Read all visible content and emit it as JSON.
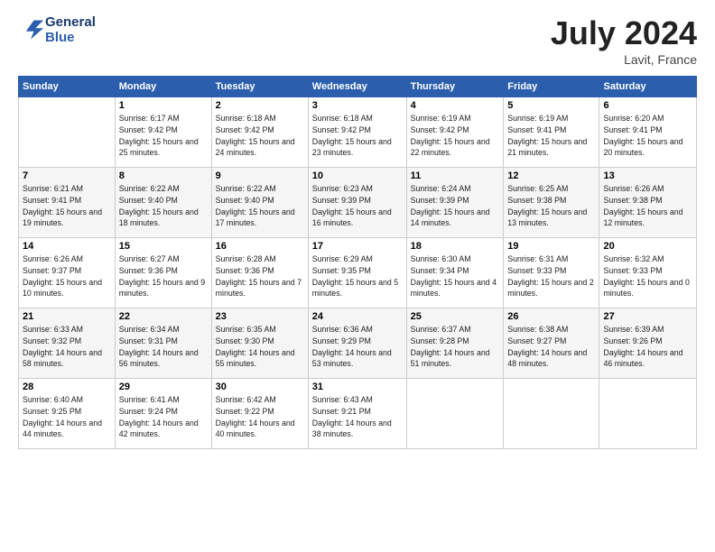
{
  "logo": {
    "line1": "General",
    "line2": "Blue"
  },
  "title": "July 2024",
  "location": "Lavit, France",
  "days_header": [
    "Sunday",
    "Monday",
    "Tuesday",
    "Wednesday",
    "Thursday",
    "Friday",
    "Saturday"
  ],
  "weeks": [
    [
      {
        "day": "",
        "sunrise": "",
        "sunset": "",
        "daylight": ""
      },
      {
        "day": "1",
        "sunrise": "Sunrise: 6:17 AM",
        "sunset": "Sunset: 9:42 PM",
        "daylight": "Daylight: 15 hours and 25 minutes."
      },
      {
        "day": "2",
        "sunrise": "Sunrise: 6:18 AM",
        "sunset": "Sunset: 9:42 PM",
        "daylight": "Daylight: 15 hours and 24 minutes."
      },
      {
        "day": "3",
        "sunrise": "Sunrise: 6:18 AM",
        "sunset": "Sunset: 9:42 PM",
        "daylight": "Daylight: 15 hours and 23 minutes."
      },
      {
        "day": "4",
        "sunrise": "Sunrise: 6:19 AM",
        "sunset": "Sunset: 9:42 PM",
        "daylight": "Daylight: 15 hours and 22 minutes."
      },
      {
        "day": "5",
        "sunrise": "Sunrise: 6:19 AM",
        "sunset": "Sunset: 9:41 PM",
        "daylight": "Daylight: 15 hours and 21 minutes."
      },
      {
        "day": "6",
        "sunrise": "Sunrise: 6:20 AM",
        "sunset": "Sunset: 9:41 PM",
        "daylight": "Daylight: 15 hours and 20 minutes."
      }
    ],
    [
      {
        "day": "7",
        "sunrise": "Sunrise: 6:21 AM",
        "sunset": "Sunset: 9:41 PM",
        "daylight": "Daylight: 15 hours and 19 minutes."
      },
      {
        "day": "8",
        "sunrise": "Sunrise: 6:22 AM",
        "sunset": "Sunset: 9:40 PM",
        "daylight": "Daylight: 15 hours and 18 minutes."
      },
      {
        "day": "9",
        "sunrise": "Sunrise: 6:22 AM",
        "sunset": "Sunset: 9:40 PM",
        "daylight": "Daylight: 15 hours and 17 minutes."
      },
      {
        "day": "10",
        "sunrise": "Sunrise: 6:23 AM",
        "sunset": "Sunset: 9:39 PM",
        "daylight": "Daylight: 15 hours and 16 minutes."
      },
      {
        "day": "11",
        "sunrise": "Sunrise: 6:24 AM",
        "sunset": "Sunset: 9:39 PM",
        "daylight": "Daylight: 15 hours and 14 minutes."
      },
      {
        "day": "12",
        "sunrise": "Sunrise: 6:25 AM",
        "sunset": "Sunset: 9:38 PM",
        "daylight": "Daylight: 15 hours and 13 minutes."
      },
      {
        "day": "13",
        "sunrise": "Sunrise: 6:26 AM",
        "sunset": "Sunset: 9:38 PM",
        "daylight": "Daylight: 15 hours and 12 minutes."
      }
    ],
    [
      {
        "day": "14",
        "sunrise": "Sunrise: 6:26 AM",
        "sunset": "Sunset: 9:37 PM",
        "daylight": "Daylight: 15 hours and 10 minutes."
      },
      {
        "day": "15",
        "sunrise": "Sunrise: 6:27 AM",
        "sunset": "Sunset: 9:36 PM",
        "daylight": "Daylight: 15 hours and 9 minutes."
      },
      {
        "day": "16",
        "sunrise": "Sunrise: 6:28 AM",
        "sunset": "Sunset: 9:36 PM",
        "daylight": "Daylight: 15 hours and 7 minutes."
      },
      {
        "day": "17",
        "sunrise": "Sunrise: 6:29 AM",
        "sunset": "Sunset: 9:35 PM",
        "daylight": "Daylight: 15 hours and 5 minutes."
      },
      {
        "day": "18",
        "sunrise": "Sunrise: 6:30 AM",
        "sunset": "Sunset: 9:34 PM",
        "daylight": "Daylight: 15 hours and 4 minutes."
      },
      {
        "day": "19",
        "sunrise": "Sunrise: 6:31 AM",
        "sunset": "Sunset: 9:33 PM",
        "daylight": "Daylight: 15 hours and 2 minutes."
      },
      {
        "day": "20",
        "sunrise": "Sunrise: 6:32 AM",
        "sunset": "Sunset: 9:33 PM",
        "daylight": "Daylight: 15 hours and 0 minutes."
      }
    ],
    [
      {
        "day": "21",
        "sunrise": "Sunrise: 6:33 AM",
        "sunset": "Sunset: 9:32 PM",
        "daylight": "Daylight: 14 hours and 58 minutes."
      },
      {
        "day": "22",
        "sunrise": "Sunrise: 6:34 AM",
        "sunset": "Sunset: 9:31 PM",
        "daylight": "Daylight: 14 hours and 56 minutes."
      },
      {
        "day": "23",
        "sunrise": "Sunrise: 6:35 AM",
        "sunset": "Sunset: 9:30 PM",
        "daylight": "Daylight: 14 hours and 55 minutes."
      },
      {
        "day": "24",
        "sunrise": "Sunrise: 6:36 AM",
        "sunset": "Sunset: 9:29 PM",
        "daylight": "Daylight: 14 hours and 53 minutes."
      },
      {
        "day": "25",
        "sunrise": "Sunrise: 6:37 AM",
        "sunset": "Sunset: 9:28 PM",
        "daylight": "Daylight: 14 hours and 51 minutes."
      },
      {
        "day": "26",
        "sunrise": "Sunrise: 6:38 AM",
        "sunset": "Sunset: 9:27 PM",
        "daylight": "Daylight: 14 hours and 48 minutes."
      },
      {
        "day": "27",
        "sunrise": "Sunrise: 6:39 AM",
        "sunset": "Sunset: 9:26 PM",
        "daylight": "Daylight: 14 hours and 46 minutes."
      }
    ],
    [
      {
        "day": "28",
        "sunrise": "Sunrise: 6:40 AM",
        "sunset": "Sunset: 9:25 PM",
        "daylight": "Daylight: 14 hours and 44 minutes."
      },
      {
        "day": "29",
        "sunrise": "Sunrise: 6:41 AM",
        "sunset": "Sunset: 9:24 PM",
        "daylight": "Daylight: 14 hours and 42 minutes."
      },
      {
        "day": "30",
        "sunrise": "Sunrise: 6:42 AM",
        "sunset": "Sunset: 9:22 PM",
        "daylight": "Daylight: 14 hours and 40 minutes."
      },
      {
        "day": "31",
        "sunrise": "Sunrise: 6:43 AM",
        "sunset": "Sunset: 9:21 PM",
        "daylight": "Daylight: 14 hours and 38 minutes."
      },
      {
        "day": "",
        "sunrise": "",
        "sunset": "",
        "daylight": ""
      },
      {
        "day": "",
        "sunrise": "",
        "sunset": "",
        "daylight": ""
      },
      {
        "day": "",
        "sunrise": "",
        "sunset": "",
        "daylight": ""
      }
    ]
  ]
}
